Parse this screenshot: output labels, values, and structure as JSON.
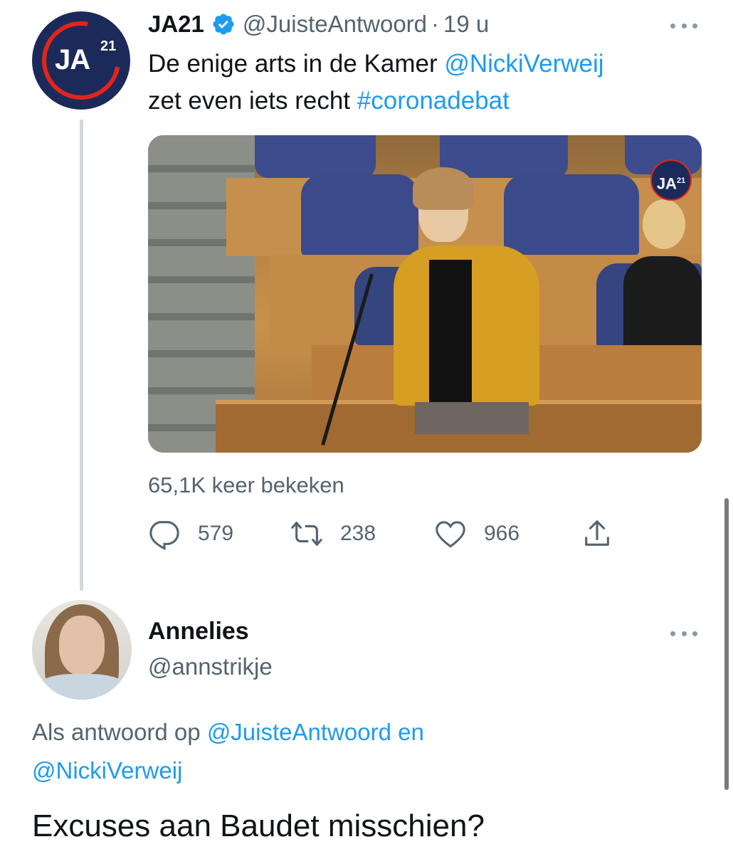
{
  "tweet": {
    "author": {
      "display_name": "JA21",
      "verified": true,
      "handle": "@JuisteAntwoord",
      "separator": "·",
      "time": "19 u",
      "avatar_logo": "JA",
      "avatar_logo_number": "21"
    },
    "text_parts": {
      "part1": "De enige arts in de Kamer ",
      "mention": "@NickiVerweij",
      "part2": "zet even iets recht ",
      "hashtag": "#coronadebat"
    },
    "media": {
      "icon": "video-thumbnail",
      "watermark": "JA",
      "watermark_number": "21"
    },
    "views": "65,1K keer bekeken",
    "actions": {
      "reply_count": "579",
      "retweet_count": "238",
      "like_count": "966"
    }
  },
  "reply": {
    "display_name": "Annelies",
    "handle": "@annstrikje",
    "reply_to": {
      "prefix": "Als antwoord op ",
      "mention1": "@JuisteAntwoord",
      "joiner": " en",
      "mention2": "@NickiVerweij"
    },
    "text": "Excuses aan Baudet misschien?"
  },
  "colors": {
    "accent": "#1d9bf0",
    "secondary_text": "#536471",
    "thread_line": "#cfd9de",
    "brand_navy": "#1c2a5a",
    "brand_red": "#e1251b"
  }
}
